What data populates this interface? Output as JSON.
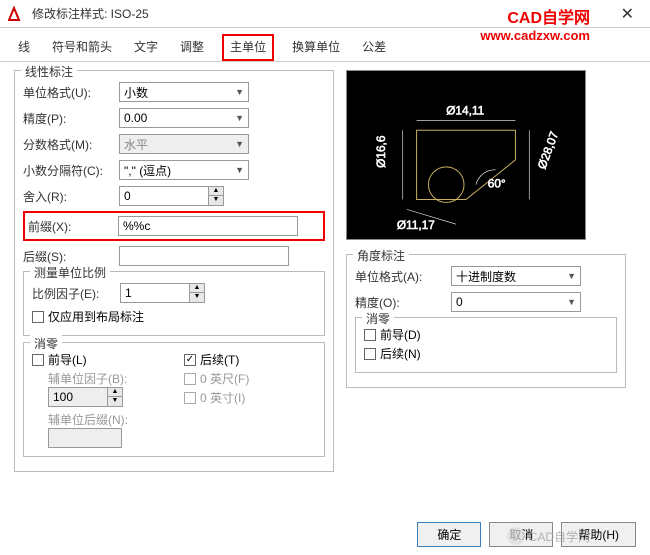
{
  "window": {
    "title": "修改标注样式: ISO-25",
    "brand_title": "CAD自学网",
    "brand_url": "www.cadzxw.com"
  },
  "tabs": {
    "lines": "线",
    "symbols": "符号和箭头",
    "text": "文字",
    "fit": "调整",
    "primary": "主单位",
    "alternate": "换算单位",
    "tolerance": "公差"
  },
  "linear": {
    "title": "线性标注",
    "unit_format_label": "单位格式(U):",
    "unit_format_value": "小数",
    "precision_label": "精度(P):",
    "precision_value": "0.00",
    "fraction_label": "分数格式(M):",
    "fraction_value": "水平",
    "decimal_sep_label": "小数分隔符(C):",
    "decimal_sep_value": "\",\" (逗点)",
    "roundoff_label": "舍入(R):",
    "roundoff_value": "0",
    "prefix_label": "前缀(X):",
    "prefix_value": "%%c",
    "suffix_label": "后缀(S):",
    "suffix_value": ""
  },
  "scale": {
    "title": "测量单位比例",
    "factor_label": "比例因子(E):",
    "factor_value": "1",
    "layout_only": "仅应用到布局标注"
  },
  "zero": {
    "title": "消零",
    "leading": "前导(L)",
    "trailing": "后续(T)",
    "subunit_factor_label": "辅单位因子(B):",
    "subunit_factor_value": "100",
    "subunit_suffix_label": "辅单位后缀(N):",
    "subunit_suffix_value": "",
    "zero_ft": "0 英尺(F)",
    "zero_in": "0 英寸(I)"
  },
  "angular": {
    "title": "角度标注",
    "unit_format_label": "单位格式(A):",
    "unit_format_value": "十进制度数",
    "precision_label": "精度(O):",
    "precision_value": "0",
    "zero_title": "消零",
    "leading": "前导(D)",
    "trailing": "后续(N)"
  },
  "preview": {
    "dim_top": "Ø14,11",
    "dim_left": "Ø16,6",
    "dim_bl": "Ø11,17",
    "dim_right": "Ø28,07",
    "angle": "60°"
  },
  "buttons": {
    "ok": "确定",
    "cancel": "取消",
    "help": "帮助(H)"
  },
  "watermark": "CAD自学网"
}
